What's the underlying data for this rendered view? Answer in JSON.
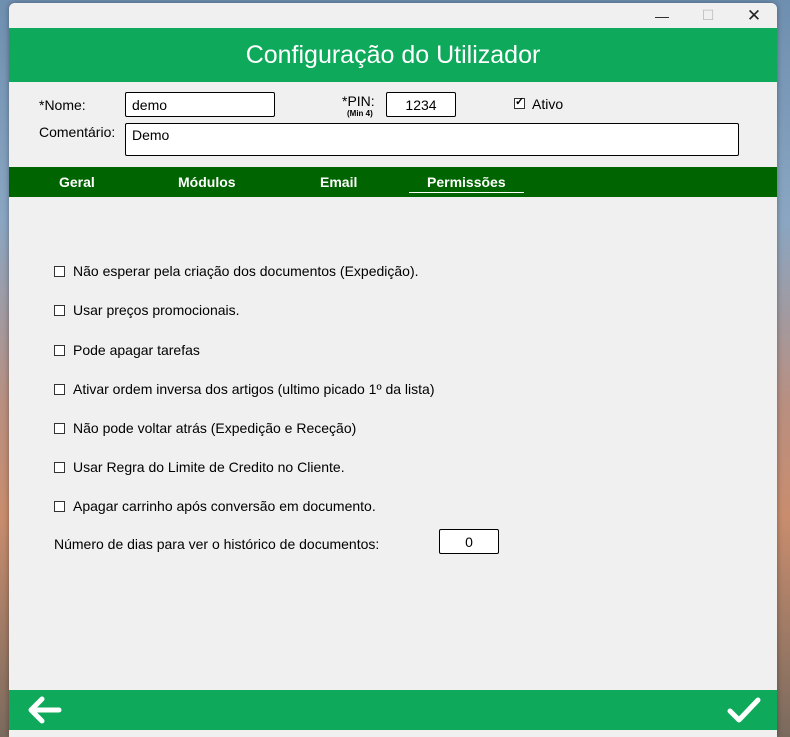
{
  "window": {
    "controls": {
      "minimize": "—",
      "maximize": "☐",
      "close": "✕"
    }
  },
  "header": {
    "title": "Configuração do Utilizador"
  },
  "form": {
    "name_label": "*Nome:",
    "name_value": "demo",
    "pin_label": "*PIN:",
    "pin_hint": "(Min 4)",
    "pin_value": "1234",
    "active_label": "Ativo",
    "active_checked": true,
    "comment_label": "Comentário:",
    "comment_value": "Demo"
  },
  "tabs": [
    {
      "label": "Geral",
      "active": false
    },
    {
      "label": "Módulos",
      "active": false
    },
    {
      "label": "Email",
      "active": false
    },
    {
      "label": "Permissões",
      "active": true
    }
  ],
  "permissions": [
    {
      "label": "Não esperar pela criação dos documentos (Expedição).",
      "checked": false
    },
    {
      "label": "Usar preços promocionais.",
      "checked": false
    },
    {
      "label": "Pode apagar tarefas",
      "checked": false
    },
    {
      "label": "Ativar ordem inversa dos artigos (ultimo picado 1º da lista)",
      "checked": false
    },
    {
      "label": "Não pode voltar atrás (Expedição e Receção)",
      "checked": false
    },
    {
      "label": "Usar Regra do Limite de Credito no Cliente.",
      "checked": false
    },
    {
      "label": "Apagar carrinho após conversão em documento.",
      "checked": false
    }
  ],
  "history": {
    "label": "Número de dias para ver o histórico de documentos:",
    "value": "0"
  },
  "footer": {
    "back_icon": "arrow-left-icon",
    "confirm_icon": "checkmark-icon"
  },
  "colors": {
    "header_green": "#0fa95c",
    "tab_green": "#006400"
  }
}
